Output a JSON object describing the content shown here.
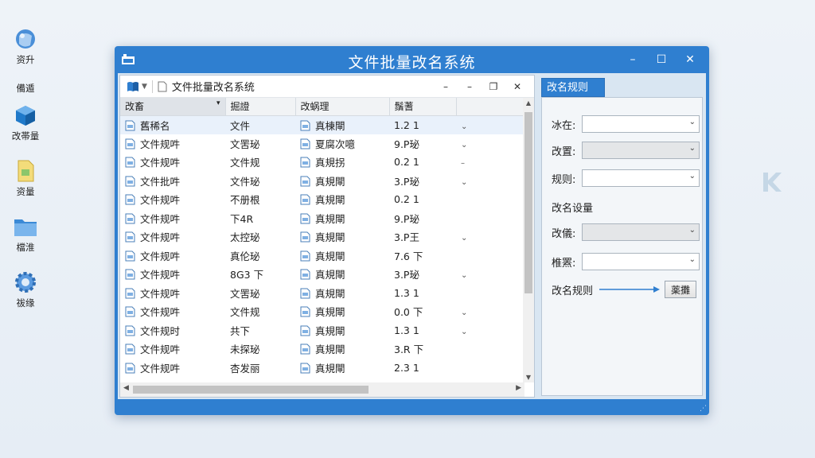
{
  "desktop": {
    "icons": [
      {
        "label": "资升",
        "icon": "sphere-icon"
      },
      {
        "label": "備遁",
        "icon": "none"
      },
      {
        "label": "改帯量",
        "icon": "cube-icon"
      },
      {
        "label": "资量",
        "icon": "document-icon"
      },
      {
        "label": "檔淮",
        "icon": "folder-icon"
      },
      {
        "label": "祓缘",
        "icon": "gear-icon"
      }
    ]
  },
  "window": {
    "title": "文件批量改名系统",
    "controls": {
      "minimize": "–",
      "maximize": "☐",
      "close": "✕"
    }
  },
  "explorer": {
    "path": "文件批量改名系统",
    "controls": {
      "minimize": "–",
      "min2": "–",
      "restore": "❐",
      "close": "✕"
    },
    "columns": [
      "改畜",
      "掘證",
      "改蜗理",
      "鬚蓍",
      ""
    ],
    "rows": [
      {
        "name": "舊稀名",
        "type": "文件",
        "rule": "真棟閘",
        "size": "1.2 1",
        "chev": "⌄"
      },
      {
        "name": "文件规吽",
        "type": "文罟珌",
        "rule": "夏腐次噫",
        "size": "9.P珌",
        "chev": "⌄"
      },
      {
        "name": "文件规吽",
        "type": "文件规",
        "rule": "真規拐",
        "size": "0.2 1",
        "chev": "–"
      },
      {
        "name": "文件批吽",
        "type": "文件珌",
        "rule": "真規閘",
        "size": "3.P珌",
        "chev": "⌄"
      },
      {
        "name": "文件规吽",
        "type": "不册根",
        "rule": "真規閘",
        "size": "0.2 1",
        "chev": ""
      },
      {
        "name": "文件规吽",
        "type": "下4R",
        "rule": "真規閘",
        "size": "9.P珌",
        "chev": ""
      },
      {
        "name": "文件规吽",
        "type": "太控珌",
        "rule": "真規閘",
        "size": "3.P王",
        "chev": "⌄"
      },
      {
        "name": "文件规吽",
        "type": "真伦珌",
        "rule": "真規閘",
        "size": "7.6 下",
        "chev": ""
      },
      {
        "name": "文件规吽",
        "type": "8G3 下",
        "rule": "真規閘",
        "size": "3.P珌",
        "chev": "⌄"
      },
      {
        "name": "文件规吽",
        "type": "文罟珌",
        "rule": "真規閘",
        "size": "1.3 1",
        "chev": ""
      },
      {
        "name": "文件规吽",
        "type": "文件规",
        "rule": "真規閘",
        "size": "0.0 下",
        "chev": "⌄"
      },
      {
        "name": "文件规时",
        "type": "共下",
        "rule": "真規閘",
        "size": "1.3 1",
        "chev": "⌄"
      },
      {
        "name": "文件规吽",
        "type": "未探珌",
        "rule": "真規閘",
        "size": "3.R 下",
        "chev": ""
      },
      {
        "name": "文件规吽",
        "type": "杏发丽",
        "rule": "真規閘",
        "size": "2.3 1",
        "chev": ""
      }
    ]
  },
  "rules": {
    "tab": "改名规则",
    "fields": [
      {
        "label": "冰在:",
        "disabled": false
      },
      {
        "label": "改置:",
        "disabled": true
      },
      {
        "label": "规则:",
        "disabled": false
      }
    ],
    "section": "改名设量",
    "fields2": [
      {
        "label": "改儀:",
        "disabled": true
      },
      {
        "label": "椎罴:",
        "disabled": false
      }
    ],
    "apply_label": "改名规则",
    "apply_button": "薬攤"
  }
}
